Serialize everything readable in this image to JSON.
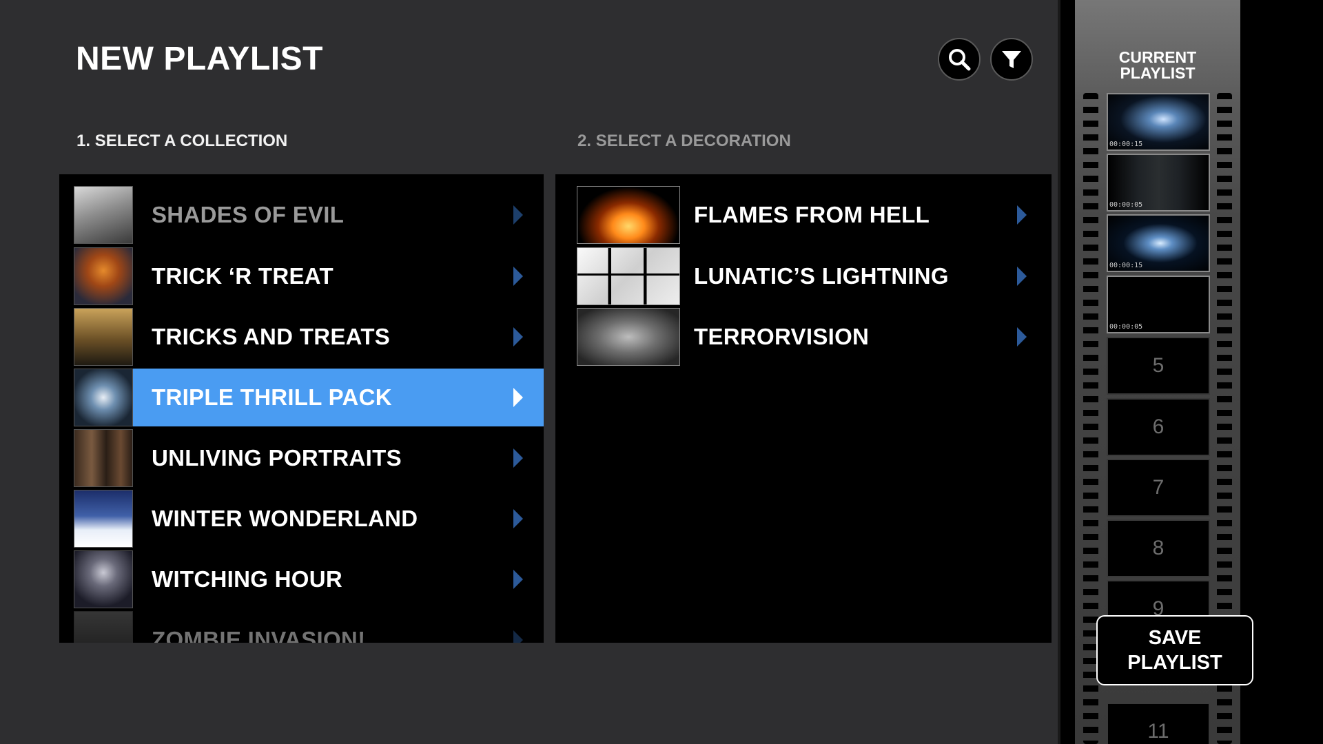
{
  "header": {
    "title": "NEW PLAYLIST",
    "search_icon": "search-icon",
    "filter_icon": "filter-icon"
  },
  "steps": {
    "collection_label": "1. SELECT A COLLECTION",
    "decoration_label": "2. SELECT A DECORATION"
  },
  "collections": [
    {
      "label": "SHADES OF EVIL",
      "state": "dimmed"
    },
    {
      "label": "TRICK ‘R TREAT",
      "state": "normal"
    },
    {
      "label": "TRICKS AND TREATS",
      "state": "normal"
    },
    {
      "label": "TRIPLE THRILL PACK",
      "state": "selected"
    },
    {
      "label": "UNLIVING PORTRAITS",
      "state": "normal"
    },
    {
      "label": "WINTER WONDERLAND",
      "state": "normal"
    },
    {
      "label": "WITCHING HOUR",
      "state": "normal"
    },
    {
      "label": "ZOMBIE INVASION!",
      "state": "partially-visible"
    }
  ],
  "decorations": [
    {
      "label": "FLAMES FROM HELL"
    },
    {
      "label": "LUNATIC’S LIGHTNING"
    },
    {
      "label": "TERRORVISION"
    }
  ],
  "playlist": {
    "title_line1": "CURRENT",
    "title_line2": "PLAYLIST",
    "frames": [
      {
        "time": "00:00:15"
      },
      {
        "time": "00:00:05"
      },
      {
        "time": "00:00:15"
      },
      {
        "time": "00:00:05"
      },
      {
        "slot": "5"
      },
      {
        "slot": "6"
      },
      {
        "slot": "7"
      },
      {
        "slot": "8"
      },
      {
        "slot": "9"
      },
      {
        "slot": "11"
      }
    ],
    "save_line1": "SAVE",
    "save_line2": "PLAYLIST"
  },
  "colors": {
    "background": "#2e2e30",
    "panel": "#000000",
    "selected_row": "#4a9cf2",
    "chevron": "#2c5a9a"
  }
}
